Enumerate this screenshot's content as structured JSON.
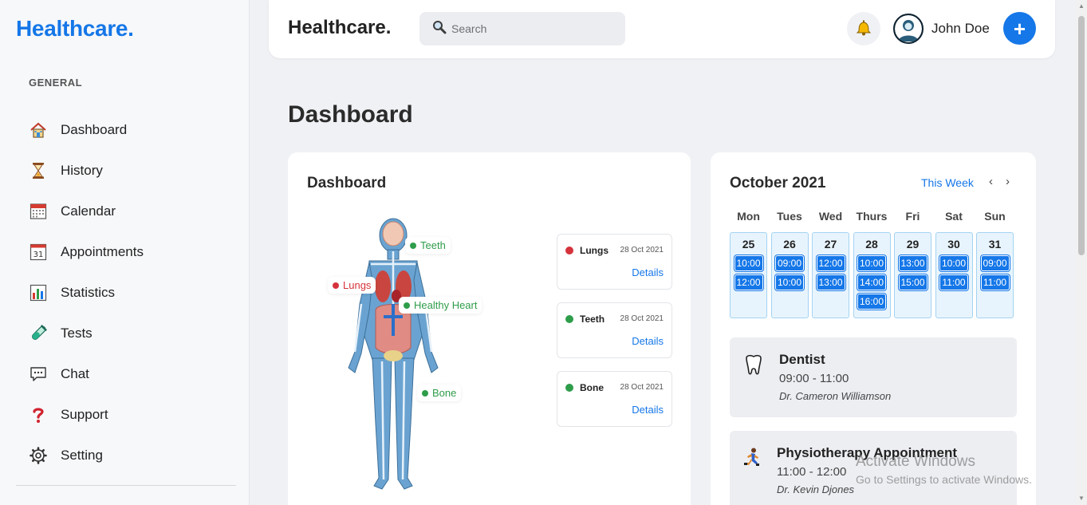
{
  "app": {
    "logo": "Healthcare."
  },
  "sidebar": {
    "section": "GENERAL",
    "items": [
      {
        "label": "Dashboard",
        "icon": "home-icon"
      },
      {
        "label": "History",
        "icon": "hourglass-icon"
      },
      {
        "label": "Calendar",
        "icon": "calendar-icon"
      },
      {
        "label": "Appointments",
        "icon": "date-icon"
      },
      {
        "label": "Statistics",
        "icon": "bar-chart-icon"
      },
      {
        "label": "Tests",
        "icon": "test-tube-icon"
      },
      {
        "label": "Chat",
        "icon": "chat-icon"
      },
      {
        "label": "Support",
        "icon": "question-icon"
      },
      {
        "label": "Setting",
        "icon": "gear-icon"
      }
    ]
  },
  "topbar": {
    "title": "Healthcare.",
    "search_placeholder": "Search",
    "user_name": "John Doe",
    "add_label": "+"
  },
  "page": {
    "title": "Dashboard"
  },
  "dashboard": {
    "title": "Dashboard",
    "body_tags": [
      {
        "label": "Teeth",
        "status": "healthy"
      },
      {
        "label": "Lungs",
        "status": "alert"
      },
      {
        "label": "Healthy Heart",
        "status": "healthy"
      },
      {
        "label": "Bone",
        "status": "healthy"
      }
    ],
    "records": [
      {
        "name": "Lungs",
        "date": "28 Oct 2021",
        "link": "Details",
        "status": "alert"
      },
      {
        "name": "Teeth",
        "date": "28 Oct 2021",
        "link": "Details",
        "status": "healthy"
      },
      {
        "name": "Bone",
        "date": "28 Oct 2021",
        "link": "Details",
        "status": "healthy"
      }
    ]
  },
  "calendar": {
    "month": "October 2021",
    "range_label": "This Week",
    "prev": "‹",
    "next": "›",
    "days": [
      {
        "name": "Mon",
        "num": "25",
        "slots": [
          "10:00",
          "12:00"
        ]
      },
      {
        "name": "Tues",
        "num": "26",
        "slots": [
          "09:00",
          "10:00"
        ]
      },
      {
        "name": "Wed",
        "num": "27",
        "slots": [
          "12:00",
          "13:00"
        ]
      },
      {
        "name": "Thurs",
        "num": "28",
        "slots": [
          "10:00",
          "14:00",
          "16:00"
        ]
      },
      {
        "name": "Fri",
        "num": "29",
        "slots": [
          "13:00",
          "15:00"
        ]
      },
      {
        "name": "Sat",
        "num": "30",
        "slots": [
          "10:00",
          "11:00"
        ]
      },
      {
        "name": "Sun",
        "num": "31",
        "slots": [
          "09:00",
          "11:00"
        ]
      }
    ],
    "appointments": [
      {
        "title": "Dentist",
        "time": "09:00 - 11:00",
        "doctor": "Dr. Cameron Williamson",
        "icon": "tooth-icon"
      },
      {
        "title": "Physiotherapy Appointment",
        "time": "11:00 - 12:00",
        "doctor": "Dr. Kevin Djones",
        "icon": "running-person-icon"
      }
    ]
  },
  "watermark": {
    "line1": "Activate Windows",
    "line2": "Go to Settings to activate Windows."
  },
  "colors": {
    "accent": "#1577e8",
    "healthy": "#2e9d4a",
    "alert": "#d5323b"
  }
}
